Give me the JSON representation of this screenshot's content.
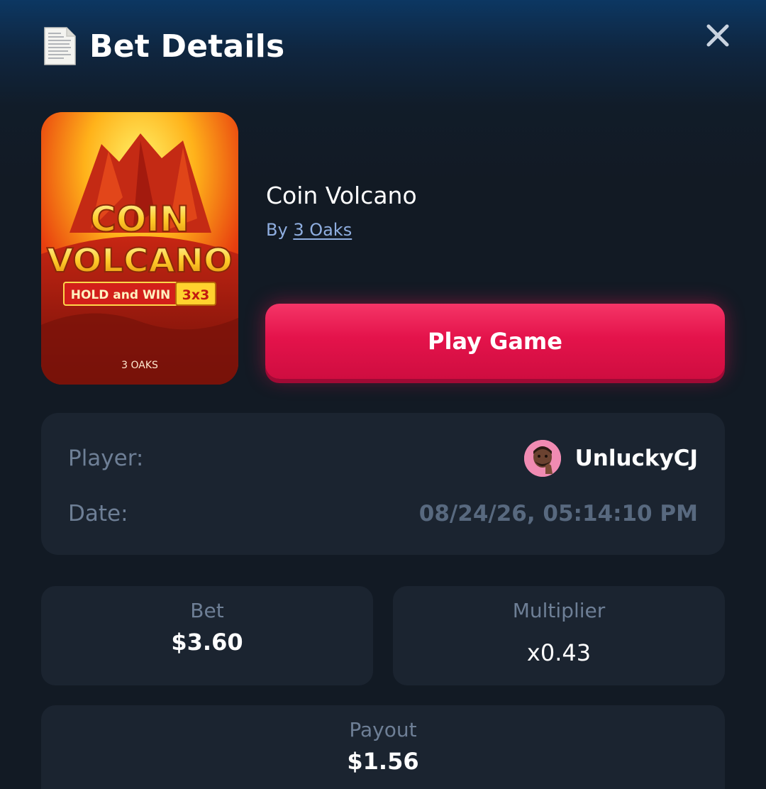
{
  "header": {
    "title": "Bet Details",
    "icon": "document-icon",
    "close_icon": "close-icon"
  },
  "game": {
    "name": "Coin Volcano",
    "provider_prefix": "By",
    "provider": "3 Oaks",
    "thumbnail": {
      "line1": "COIN",
      "line2": "VOLCANO",
      "badge_text": "HOLD and WIN",
      "badge_size": "3x3",
      "studio": "3 OAKS"
    },
    "play_label": "Play Game"
  },
  "info": {
    "player_label": "Player:",
    "player_name": "UnluckyCJ",
    "date_label": "Date:",
    "date_value": "08/24/26, 05:14:10 PM"
  },
  "stats": {
    "bet_label": "Bet",
    "bet_value": "$3.60",
    "multiplier_label": "Multiplier",
    "multiplier_value": "x0.43",
    "payout_label": "Payout",
    "payout_value": "$1.56"
  },
  "colors": {
    "accent": "#e4134b",
    "background": "#121a24",
    "card": "#1b2430",
    "link": "#8faee0"
  }
}
